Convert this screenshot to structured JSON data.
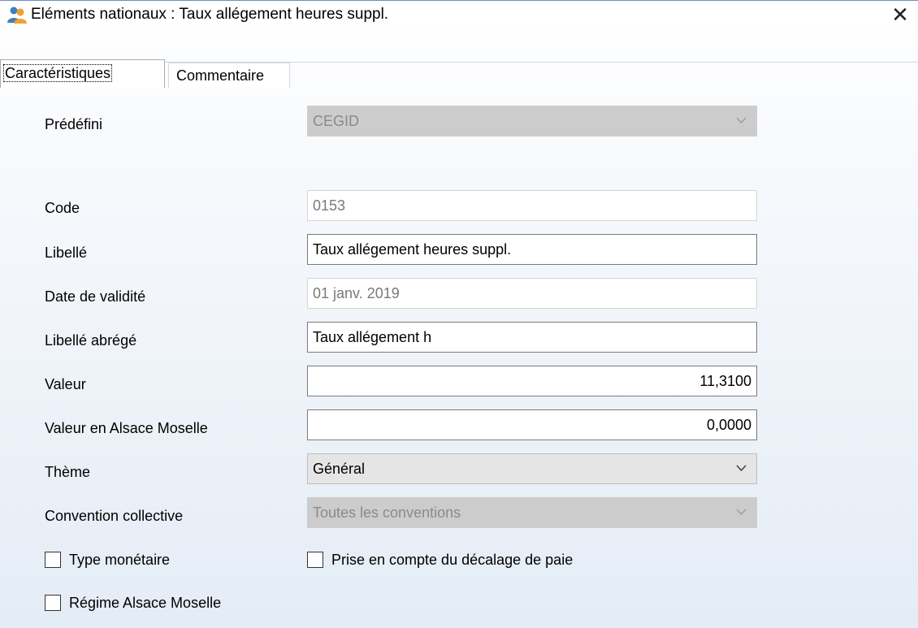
{
  "window": {
    "title": "Eléments nationaux :  Taux allégement heures suppl.",
    "close_glyph": "✕",
    "app_icon": "users-icon"
  },
  "tabs": [
    {
      "label": "Caractéristiques",
      "active": true
    },
    {
      "label": "Commentaire",
      "active": false
    }
  ],
  "form": {
    "predefini": {
      "label": "Prédéfini",
      "value": "CEGID"
    },
    "code": {
      "label": "Code",
      "value": "0153"
    },
    "libelle": {
      "label": "Libellé",
      "value": "Taux allégement heures suppl."
    },
    "date_validite": {
      "label": "Date de validité",
      "value": "01 janv. 2019"
    },
    "libelle_abrege": {
      "label": "Libellé abrégé",
      "value": "Taux allégement h"
    },
    "valeur": {
      "label": "Valeur",
      "value": "11,3100"
    },
    "valeur_alsace": {
      "label": "Valeur en Alsace Moselle",
      "value": "0,0000"
    },
    "theme": {
      "label": "Thème",
      "value": "Général"
    },
    "convention": {
      "label": "Convention collective",
      "value": "Toutes les conventions"
    }
  },
  "checkboxes": {
    "type_monetaire": {
      "label": "Type monétaire",
      "checked": false
    },
    "decalage_paie": {
      "label": "Prise en compte du décalage de paie",
      "checked": false
    },
    "regime_alsace": {
      "label": "Régime Alsace Moselle",
      "checked": false
    }
  }
}
